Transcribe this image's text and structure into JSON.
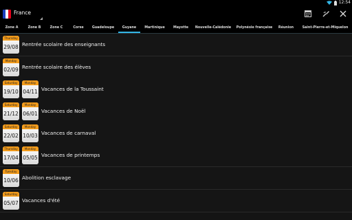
{
  "status_bar": {
    "time": "12:54"
  },
  "action_bar": {
    "title": "France",
    "flag_colors": [
      "#1d3fbe",
      "#ffffff",
      "#e3001b"
    ],
    "actions": [
      {
        "icon": "calendar-grid-icon"
      },
      {
        "icon": "brush-tools-icon"
      },
      {
        "icon": "close-icon"
      }
    ]
  },
  "tabs": [
    {
      "label": "Zone A",
      "active": false
    },
    {
      "label": "Zone B",
      "active": false
    },
    {
      "label": "Zone C",
      "active": false
    },
    {
      "label": "Corse",
      "active": false
    },
    {
      "label": "Guadeloupe",
      "active": false
    },
    {
      "label": "Guyane",
      "active": true
    },
    {
      "label": "Martinique",
      "active": false
    },
    {
      "label": "Mayotte",
      "active": false
    },
    {
      "label": "Nouvelle-Calédonie",
      "active": false
    },
    {
      "label": "Polynésie française",
      "active": false
    },
    {
      "label": "Réunion",
      "active": false
    },
    {
      "label": "Saint-Pierre-et-Miquelon",
      "active": false
    }
  ],
  "colors": {
    "accent": "#33b5e5",
    "calendar_header": "#f29b1b"
  },
  "events": [
    {
      "label": "Rentrée scolaire des enseignants",
      "dates": [
        {
          "day": "Thursday",
          "date": "29/08"
        }
      ]
    },
    {
      "label": "Rentrée scolaire des élèves",
      "dates": [
        {
          "day": "Monday",
          "date": "02/09"
        }
      ]
    },
    {
      "label": "Vacances de la Toussaint",
      "dates": [
        {
          "day": "Saturday",
          "date": "19/10"
        },
        {
          "day": "Monday",
          "date": "04/11"
        }
      ]
    },
    {
      "label": "Vacances de Noël",
      "dates": [
        {
          "day": "Saturday",
          "date": "21/12"
        },
        {
          "day": "Monday",
          "date": "06/01"
        }
      ]
    },
    {
      "label": "Vacances de carnaval",
      "dates": [
        {
          "day": "Saturday",
          "date": "22/02"
        },
        {
          "day": "Monday",
          "date": "10/03"
        }
      ]
    },
    {
      "label": "Vacances de printemps",
      "dates": [
        {
          "day": "Thursday",
          "date": "17/04"
        },
        {
          "day": "Monday",
          "date": "05/05"
        }
      ]
    },
    {
      "label": "Abolition esclavage",
      "dates": [
        {
          "day": "Tuesday",
          "date": "10/06"
        }
      ]
    },
    {
      "label": "Vacances d'été",
      "dates": [
        {
          "day": "Saturday",
          "date": "05/07"
        }
      ]
    }
  ]
}
